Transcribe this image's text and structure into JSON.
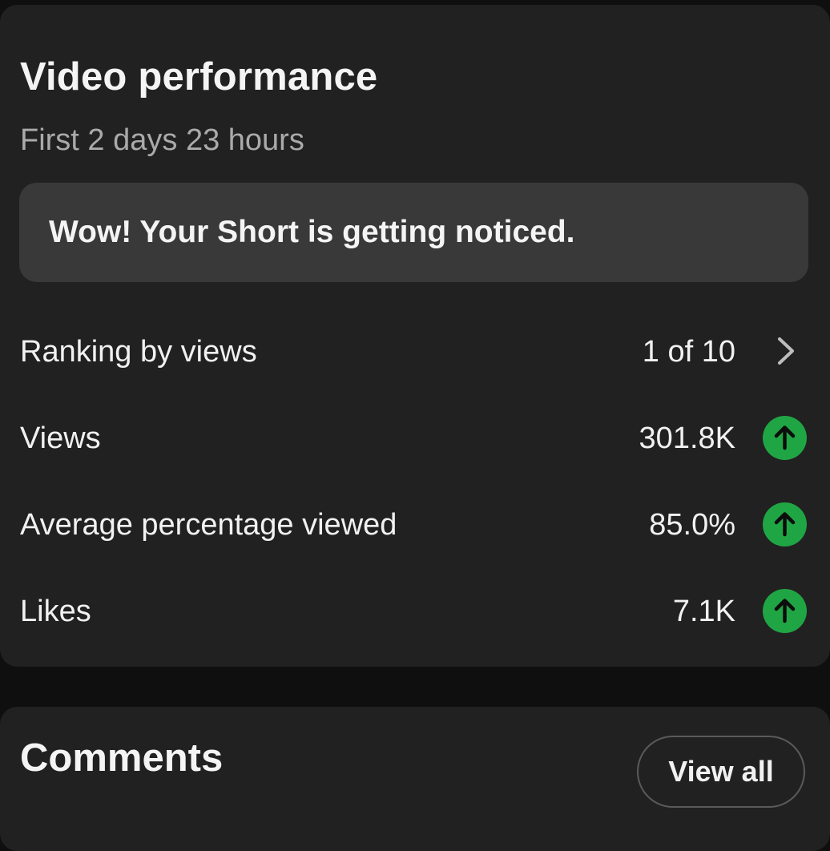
{
  "performance": {
    "title": "Video performance",
    "subtitle": "First 2 days 23 hours",
    "banner": "Wow! Your Short is getting noticed.",
    "metrics": [
      {
        "label": "Ranking by views",
        "value": "1 of 10",
        "icon": "chevron-right-icon"
      },
      {
        "label": "Views",
        "value": "301.8K",
        "icon": "arrow-up-circle-icon"
      },
      {
        "label": "Average percentage viewed",
        "value": "85.0%",
        "icon": "arrow-up-circle-icon"
      },
      {
        "label": "Likes",
        "value": "7.1K",
        "icon": "arrow-up-circle-icon"
      }
    ],
    "colors": {
      "card_background": "#212121",
      "page_background": "#0f0f0f",
      "trend_up": "#20a544",
      "subtitle_text": "#aaaaaa"
    }
  },
  "comments": {
    "title": "Comments",
    "view_all_label": "View all"
  }
}
